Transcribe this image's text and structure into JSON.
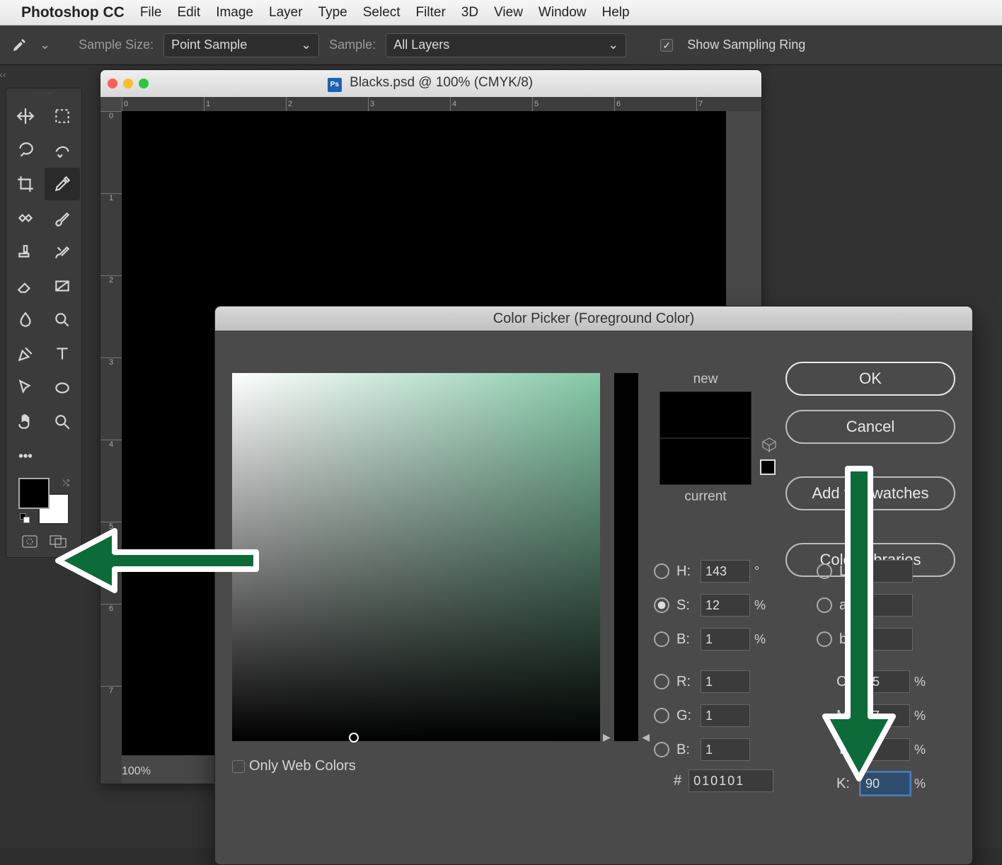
{
  "menubar": {
    "app": "Photoshop CC",
    "items": [
      "File",
      "Edit",
      "Image",
      "Layer",
      "Type",
      "Select",
      "Filter",
      "3D",
      "View",
      "Window",
      "Help"
    ]
  },
  "options_bar": {
    "sample_size_label": "Sample Size:",
    "sample_size_value": "Point Sample",
    "sample_label": "Sample:",
    "sample_value": "All Layers",
    "show_sampling_ring": "Show Sampling Ring",
    "show_sampling_ring_checked": true
  },
  "document": {
    "title": "Blacks.psd @ 100% (CMYK/8)",
    "zoom": "100%",
    "ruler_marks": [
      "0",
      "1",
      "2",
      "3",
      "4",
      "5",
      "6",
      "7"
    ]
  },
  "tools": {
    "items": [
      "move-tool",
      "marquee-tool",
      "lasso-tool",
      "quick-select-tool",
      "crop-tool",
      "eyedropper-tool",
      "healing-tool",
      "brush-tool",
      "stamp-tool",
      "history-brush-tool",
      "eraser-tool",
      "gradient-tool",
      "blur-tool",
      "dodge-tool",
      "pen-tool",
      "type-tool",
      "path-select-tool",
      "ellipse-tool",
      "hand-tool",
      "zoom-tool",
      "more-tool",
      ""
    ],
    "active": "eyedropper-tool"
  },
  "foreground_color": "#000000",
  "background_color": "#ffffff",
  "color_picker": {
    "title": "Color Picker (Foreground Color)",
    "ok": "OK",
    "cancel": "Cancel",
    "swatches": "Add to Swatches",
    "libraries": "Color Libraries",
    "new_label": "new",
    "current_label": "current",
    "only_web_label": "Only Web Colors",
    "only_web_checked": false,
    "hsb": {
      "H": "143",
      "S": "12",
      "B": "1",
      "H_unit": "°",
      "SB_unit": "%",
      "selected": "S"
    },
    "lab": {
      "L": "",
      "a": "",
      "b": ""
    },
    "rgb": {
      "R": "1",
      "G": "1",
      "B": "1"
    },
    "cmyk": {
      "C": "75",
      "M": "67",
      "Y": "67",
      "K": "90",
      "unit": "%"
    },
    "hex": "010101",
    "hue_selector_color": "#84c9a7",
    "cursor": {
      "x_pct": 33,
      "y_pct": 99
    }
  }
}
